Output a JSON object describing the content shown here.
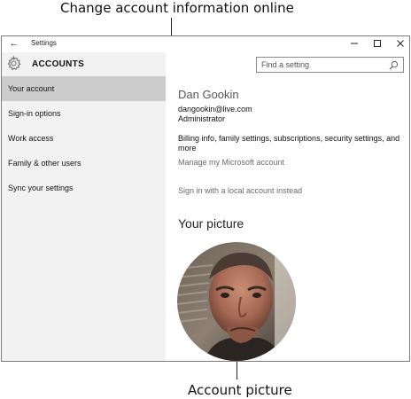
{
  "annotations": {
    "top": "Change account information online",
    "bottom": "Account picture"
  },
  "titlebar": {
    "back_icon": "back-arrow-icon",
    "title": "Settings",
    "minimize_icon": "minimize-icon",
    "maximize_icon": "maximize-icon",
    "close_icon": "close-icon"
  },
  "sidebar": {
    "header_icon": "gear-icon",
    "title": "ACCOUNTS",
    "items": [
      {
        "label": "Your account",
        "selected": true
      },
      {
        "label": "Sign-in options",
        "selected": false
      },
      {
        "label": "Work access",
        "selected": false
      },
      {
        "label": "Family & other users",
        "selected": false
      },
      {
        "label": "Sync your settings",
        "selected": false
      }
    ]
  },
  "search": {
    "placeholder": "Find a setting",
    "icon": "search-icon"
  },
  "account": {
    "name": "Dan Gookin",
    "email": "dangookin@live.com",
    "role": "Administrator",
    "billing_text": "Billing info, family settings, subscriptions, security settings, and more",
    "manage_link": "Manage my Microsoft account",
    "local_link": "Sign in with a local account instead"
  },
  "picture": {
    "title": "Your picture"
  },
  "colors": {
    "sidebar_bg": "#f2f2f2",
    "selected_bg": "#cccccc",
    "link": "#6b6b6b"
  }
}
